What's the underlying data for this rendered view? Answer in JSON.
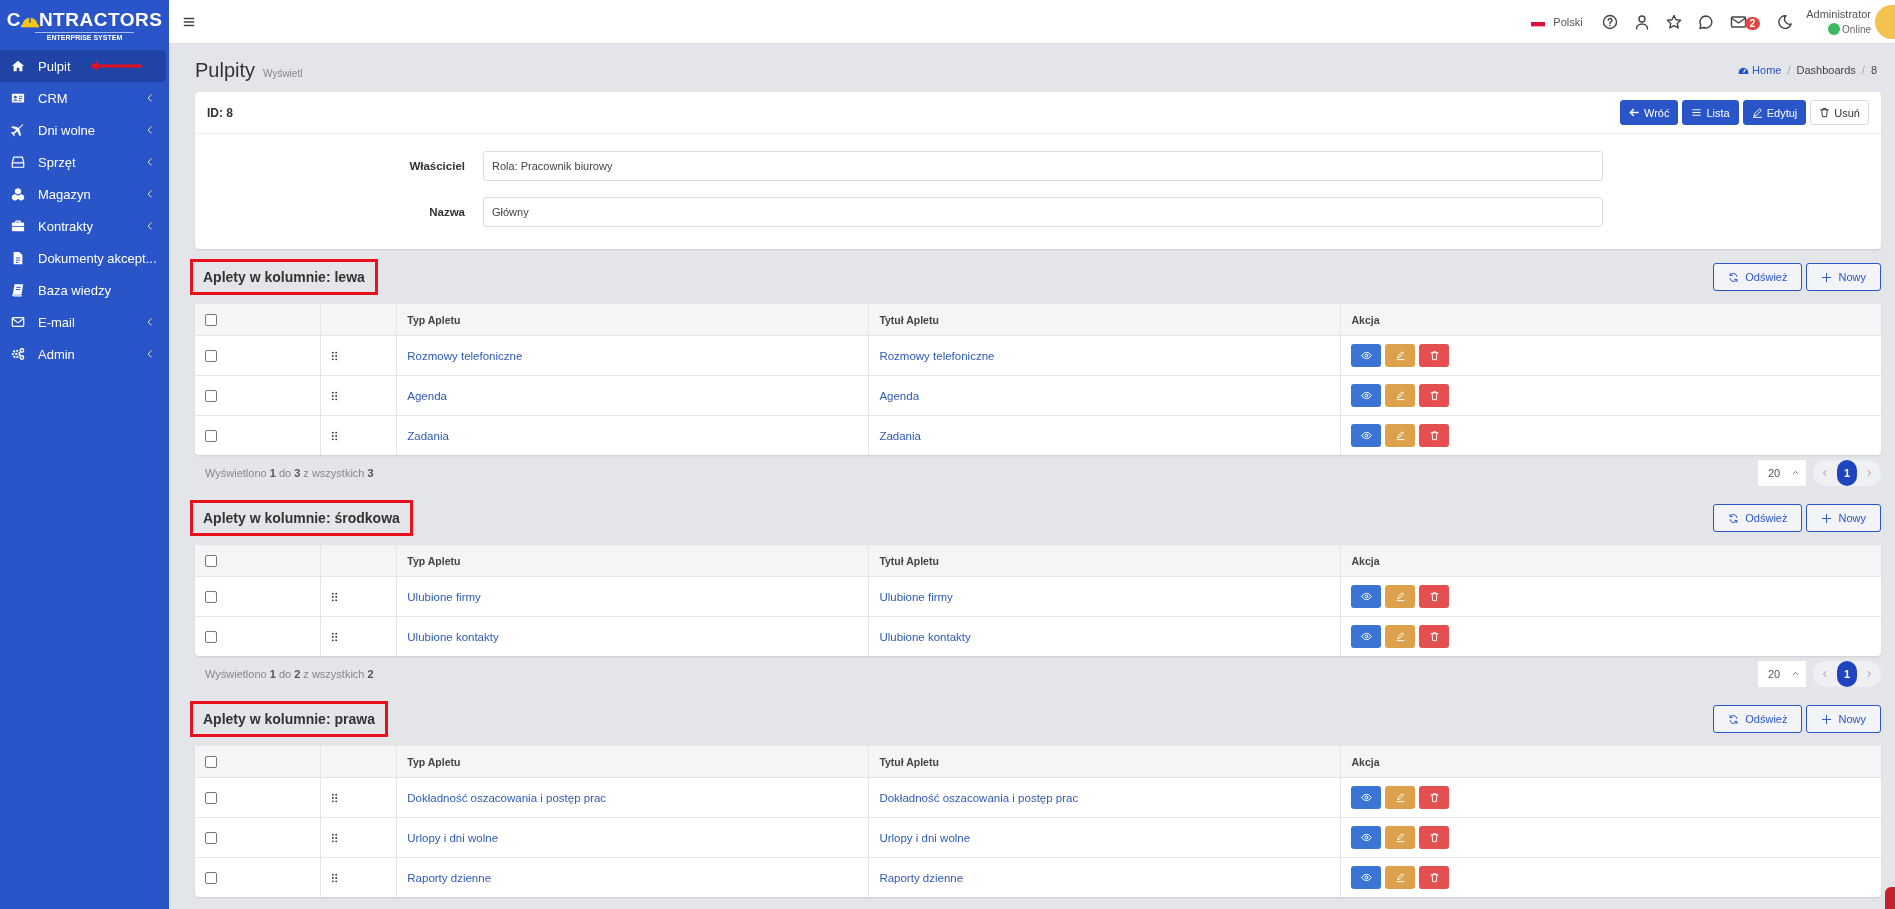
{
  "sidebar": {
    "logo": {
      "before": "C",
      "after": "NTRACTORS",
      "subtitle": "ENTERPRISE SYSTEM"
    },
    "items": [
      {
        "label": "Pulpit",
        "selected": true,
        "submenu": false,
        "arrow": true
      },
      {
        "label": "CRM",
        "selected": false,
        "submenu": true,
        "arrow": false
      },
      {
        "label": "Dni wolne",
        "selected": false,
        "submenu": true,
        "arrow": false
      },
      {
        "label": "Sprzęt",
        "selected": false,
        "submenu": true,
        "arrow": false
      },
      {
        "label": "Magazyn",
        "selected": false,
        "submenu": true,
        "arrow": false
      },
      {
        "label": "Kontrakty",
        "selected": false,
        "submenu": true,
        "arrow": false
      },
      {
        "label": "Dokumenty akcept...",
        "selected": false,
        "submenu": false,
        "arrow": false
      },
      {
        "label": "Baza wiedzy",
        "selected": false,
        "submenu": false,
        "arrow": false
      },
      {
        "label": "E-mail",
        "selected": false,
        "submenu": true,
        "arrow": false
      },
      {
        "label": "Admin",
        "selected": false,
        "submenu": true,
        "arrow": false
      }
    ]
  },
  "topbar": {
    "language": "Polski",
    "mail_badge": "2",
    "user": "Administrator",
    "status": "Online"
  },
  "page": {
    "title": "Pulpity",
    "subtitle": "Wyświetl",
    "breadcrumb": [
      "Home",
      "Dashboards",
      "8"
    ],
    "breadcrumb_separators": [
      "/",
      "/"
    ]
  },
  "record": {
    "id_label": "ID: 8",
    "buttons": [
      {
        "label": "Wróć",
        "kind": "back"
      },
      {
        "label": "Lista",
        "kind": "list"
      },
      {
        "label": "Edytuj",
        "kind": "edit"
      },
      {
        "label": "Usuń",
        "kind": "delete"
      }
    ],
    "fields": [
      {
        "label": "Właściciel",
        "value": "Rola: Pracownik biurowy"
      },
      {
        "label": "Nazwa",
        "value": "Główny"
      }
    ]
  },
  "sections": [
    {
      "title": "Aplety w kolumnie: lewa",
      "highlighted": true,
      "actions": [
        {
          "label": "Odśwież",
          "kind": "refresh"
        },
        {
          "label": "Nowy",
          "kind": "new"
        }
      ],
      "header_checked": false,
      "columns": [
        "Typ Apletu",
        "Tytuł Apletu",
        "Akcja"
      ],
      "rows": [
        {
          "type": "Rozmowy telefoniczne",
          "title": "Rozmowy telefoniczne",
          "checked": false
        },
        {
          "type": "Agenda",
          "title": "Agenda",
          "checked": false
        },
        {
          "type": "Zadania",
          "title": "Zadania",
          "checked": false
        }
      ],
      "summary": "Wyświetlono **1** do **3** z wszystkich **3**",
      "page_size": "20",
      "pages": [
        {
          "label": "1",
          "selected": true
        }
      ]
    },
    {
      "title": "Aplety w kolumnie: środkowa",
      "highlighted": true,
      "actions": [
        {
          "label": "Odśwież",
          "kind": "refresh"
        },
        {
          "label": "Nowy",
          "kind": "new"
        }
      ],
      "header_checked": false,
      "columns": [
        "Typ Apletu",
        "Tytuł Apletu",
        "Akcja"
      ],
      "rows": [
        {
          "type": "Ulubione firmy",
          "title": "Ulubione firmy",
          "checked": false
        },
        {
          "type": "Ulubione kontakty",
          "title": "Ulubione kontakty",
          "checked": false
        }
      ],
      "summary": "Wyświetlono **1** do **2** z wszystkich **2**",
      "page_size": "20",
      "pages": [
        {
          "label": "1",
          "selected": true
        }
      ]
    },
    {
      "title": "Aplety w kolumnie: prawa",
      "highlighted": true,
      "actions": [
        {
          "label": "Odśwież",
          "kind": "refresh"
        },
        {
          "label": "Nowy",
          "kind": "new"
        }
      ],
      "header_checked": false,
      "columns": [
        "Typ Apletu",
        "Tytuł Apletu",
        "Akcja"
      ],
      "rows": [
        {
          "type": "Dokładność oszacowania i postęp prac",
          "title": "Dokładność oszacowania i postęp prac",
          "checked": false
        },
        {
          "type": "Urlopy i dni wolne",
          "title": "Urlopy i dni wolne",
          "checked": false
        },
        {
          "type": "Raporty dzienne",
          "title": "Raporty dzienne",
          "checked": false
        }
      ]
    }
  ]
}
